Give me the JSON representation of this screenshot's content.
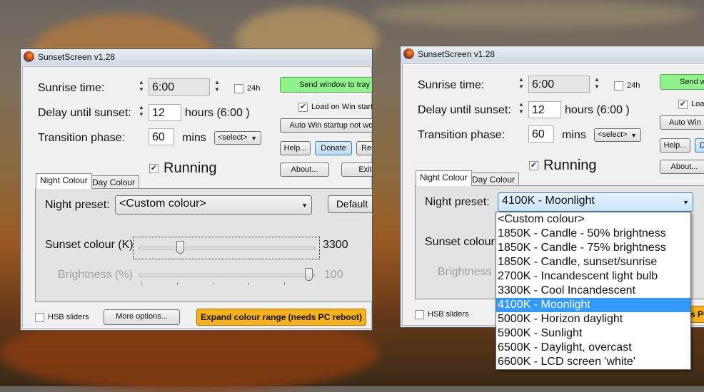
{
  "colors": {
    "accent": "#3399ff",
    "tray_button": "#8ff28a",
    "expand_button": "#f7b21b"
  },
  "window_left": {
    "title": "SunsetScreen v1.28",
    "sunrise_label": "Sunrise time:",
    "sunrise_value": "6:00",
    "h24_label": "24h",
    "delay_label": "Delay until sunset:",
    "delay_value": "12",
    "delay_unit": "hours (6:00 )",
    "transition_label": "Transition phase:",
    "transition_value": "60",
    "transition_unit": "mins",
    "select_label": "<select>",
    "tray_button": "Send window to tray",
    "load_on_startup": "Load on Win startu",
    "auto_startup_button": "Auto Win startup not work",
    "help_button": "Help...",
    "donate_button": "Donate",
    "reset_button": "Res",
    "about_button": "About...",
    "exit_button": "Exit",
    "running_label": "Running",
    "tab_night": "Night Colour",
    "tab_day": "Day Colour",
    "night_preset_label": "Night preset:",
    "night_preset_value": "<Custom colour>",
    "default_button": "Default",
    "sunset_colour_label": "Sunset colour (K)",
    "sunset_colour_value": "3300",
    "brightness_label": "Brightness (%)",
    "brightness_value": "100",
    "hsb_label": "HSB sliders",
    "more_options_button": "More options...",
    "expand_button": "Expand colour range (needs PC reboot)"
  },
  "window_right": {
    "title": "SunsetScreen v1.28",
    "sunrise_label": "Sunrise time:",
    "sunrise_value": "6:00",
    "h24_label": "24h",
    "delay_label": "Delay until sunset:",
    "delay_value": "12",
    "delay_unit": "hours (6:00 )",
    "transition_label": "Transition phase:",
    "transition_value": "60",
    "transition_unit": "mins",
    "select_label": "<select>",
    "tray_button": "Send w",
    "load_on_startup": "Loa",
    "auto_startup_button": "Auto Win",
    "help_button": "Help...",
    "donate_button": "D",
    "about_button": "About...",
    "running_label": "Running",
    "tab_night": "Night Colour",
    "tab_day": "Day Colour",
    "night_preset_label": "Night preset:",
    "night_preset_value": "4100K - Moonlight",
    "sunset_colour_label": "Sunset colour",
    "brightness_label": "Brightness (",
    "hsb_label": "HSB sliders",
    "expand_button_partial": "s PC",
    "dropdown_options": [
      "<Custom colour>",
      "1850K - Candle - 50% brightness",
      "1850K - Candle - 75% brightness",
      "1850K - Candle, sunset/sunrise",
      "2700K - Incandescent light bulb",
      "3300K - Cool Incandescent",
      "4100K - Moonlight",
      "5000K - Horizon daylight",
      "5900K - Sunlight",
      "6500K - Daylight, overcast",
      "6600K - LCD screen 'white'"
    ],
    "dropdown_selected_index": 6
  }
}
